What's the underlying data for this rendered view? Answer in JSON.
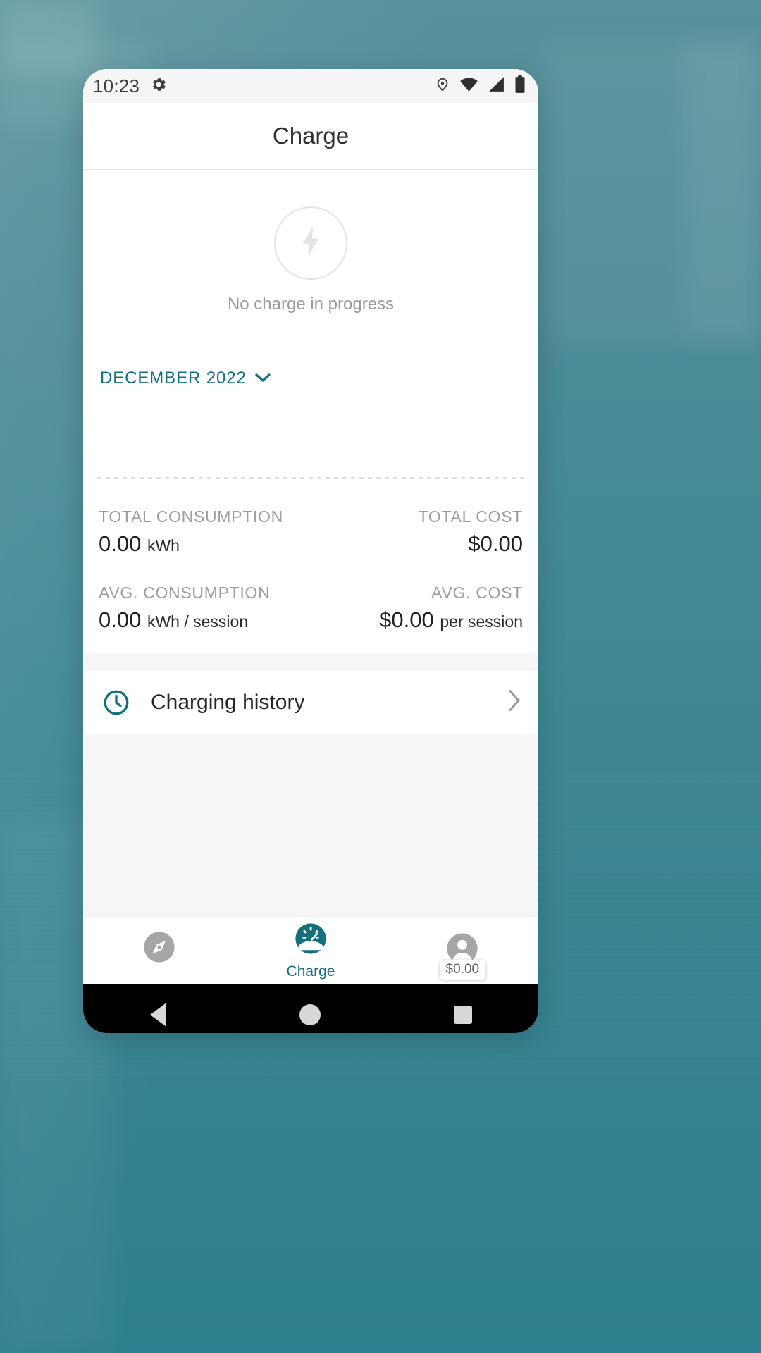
{
  "status_bar": {
    "time": "10:23",
    "left_icons": [
      "gear-icon"
    ],
    "right_icons": [
      "location-pin-icon",
      "wifi-icon",
      "cellular-signal-icon",
      "battery-icon"
    ]
  },
  "app_bar": {
    "title": "Charge"
  },
  "charge_status": {
    "icon": "lightning-bolt-icon",
    "caption": "No charge in progress"
  },
  "month_selector": {
    "label": "DECEMBER 2022",
    "icon": "chevron-down-icon",
    "accent_color": "#14707f"
  },
  "stats": [
    {
      "left": {
        "label": "TOTAL CONSUMPTION",
        "value": "0.00",
        "unit": "kWh"
      },
      "right": {
        "label": "TOTAL COST",
        "value": "$0.00",
        "unit": ""
      }
    },
    {
      "left": {
        "label": "AVG. CONSUMPTION",
        "value": "0.00",
        "unit": "kWh / session"
      },
      "right": {
        "label": "AVG. COST",
        "value": "$0.00",
        "unit": "per session"
      }
    }
  ],
  "list_rows": [
    {
      "icon": "clock-icon",
      "label": "Charging history",
      "chevron": "›"
    }
  ],
  "bottom_nav": {
    "items": [
      {
        "name": "explore",
        "icon": "compass-icon",
        "label": "",
        "active": false
      },
      {
        "name": "charge",
        "icon": "gauge-icon",
        "label": "Charge",
        "active": true
      },
      {
        "name": "account",
        "icon": "account-icon",
        "label": "",
        "active": false,
        "tooltip": "$0.00"
      }
    ]
  },
  "android_nav": {
    "buttons": [
      "back-button",
      "home-button",
      "recent-apps-button"
    ]
  },
  "colors": {
    "accent": "#14707f",
    "background": "#3f8893",
    "muted_text": "#9b9b9b"
  }
}
